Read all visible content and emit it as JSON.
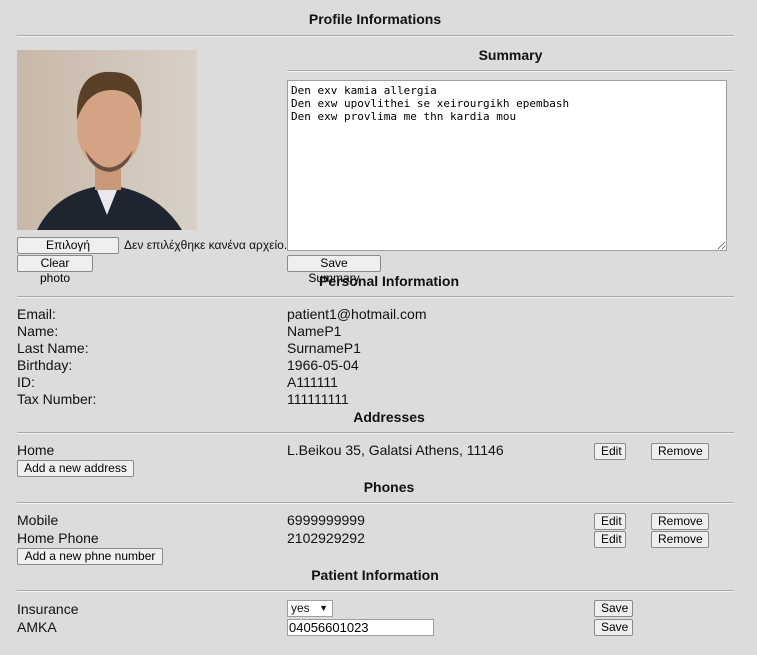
{
  "title": "Profile Informations",
  "summary": {
    "heading": "Summary",
    "text": "Den exv kamia allergia\nDen exw upovlithei se xeirourgikh epembash\nDen exw provlima me thn kardia mou",
    "save_label": "Save Summary"
  },
  "photo": {
    "choose_file_label": "Επιλογή αρχείου",
    "no_file_text": "Δεν επιλέχθηκε κανένα αρχείο.",
    "clear_label": "Clear photo"
  },
  "personal": {
    "heading": "Personal Information",
    "rows": [
      {
        "label": "Email:",
        "value": "patient1@hotmail.com"
      },
      {
        "label": "Name:",
        "value": "NameP1"
      },
      {
        "label": "Last Name:",
        "value": "SurnameP1"
      },
      {
        "label": "Birthday:",
        "value": "1966-05-04"
      },
      {
        "label": "ID:",
        "value": "A111111"
      },
      {
        "label": "Tax Number:",
        "value": "111111111"
      }
    ]
  },
  "addresses": {
    "heading": "Addresses",
    "items": [
      {
        "label": "Home",
        "value": "L.Beikou 35, Galatsi Athens, 11146"
      }
    ],
    "edit_label": "Edit",
    "remove_label": "Remove",
    "add_label": "Add a new address"
  },
  "phones": {
    "heading": "Phones",
    "items": [
      {
        "label": "Mobile",
        "value": "6999999999"
      },
      {
        "label": "Home Phone",
        "value": "2102929292"
      }
    ],
    "edit_label": "Edit",
    "remove_label": "Remove",
    "add_label": "Add a new phne number"
  },
  "patient": {
    "heading": "Patient Information",
    "insurance_label": "Insurance",
    "insurance_value": "yes",
    "amka_label": "AMKA",
    "amka_value": "04056601023",
    "save_label": "Save"
  }
}
